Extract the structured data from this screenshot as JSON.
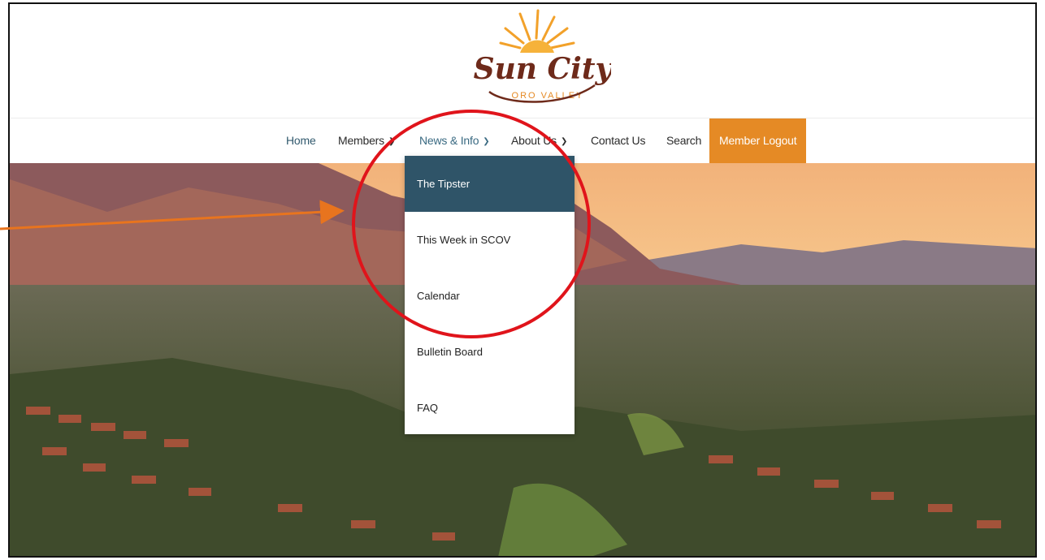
{
  "logo": {
    "name": "Sun City",
    "subtitle": "ORO VALLEY"
  },
  "nav": {
    "home": "Home",
    "members": "Members",
    "news_info": "News & Info",
    "about_us": "About Us",
    "contact_us": "Contact Us",
    "search": "Search",
    "member_logout": "Member Logout"
  },
  "dropdown": {
    "items": [
      {
        "label": "The Tipster"
      },
      {
        "label": "This Week in SCOV"
      },
      {
        "label": "Calendar"
      },
      {
        "label": "Bulletin Board"
      },
      {
        "label": "FAQ"
      }
    ]
  },
  "colors": {
    "accent_orange": "#e58a25",
    "menu_active": "#2f5468",
    "annotation_red": "#e0141b",
    "annotation_arrow": "#e8741e"
  }
}
